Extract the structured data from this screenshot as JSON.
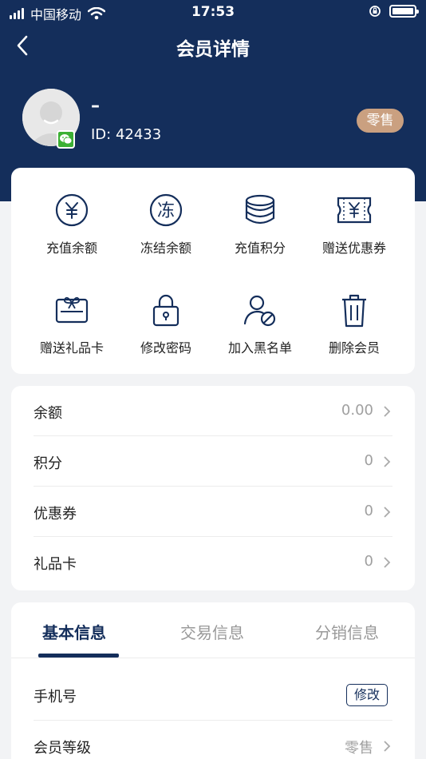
{
  "status_bar": {
    "carrier": "中国移动",
    "time": "17:53"
  },
  "nav": {
    "title": "会员详情"
  },
  "member": {
    "name": "–",
    "id": "ID: 42433",
    "level": "零售"
  },
  "actions": [
    {
      "label": "充值余额",
      "icon": "yuan-circle-icon"
    },
    {
      "label": "冻结余额",
      "icon": "freeze-icon"
    },
    {
      "label": "充值积分",
      "icon": "coin-stack-icon"
    },
    {
      "label": "赠送优惠券",
      "icon": "coupon-icon"
    },
    {
      "label": "赠送礼品卡",
      "icon": "gift-card-icon"
    },
    {
      "label": "修改密码",
      "icon": "lock-icon"
    },
    {
      "label": "加入黑名单",
      "icon": "user-blocked-icon"
    },
    {
      "label": "删除会员",
      "icon": "trash-icon"
    }
  ],
  "assets": [
    {
      "label": "余额",
      "value": "0.00"
    },
    {
      "label": "积分",
      "value": "0"
    },
    {
      "label": "优惠券",
      "value": "0"
    },
    {
      "label": "礼品卡",
      "value": "0"
    }
  ],
  "tabs": [
    {
      "label": "基本信息",
      "active": true
    },
    {
      "label": "交易信息",
      "active": false
    },
    {
      "label": "分销信息",
      "active": false
    }
  ],
  "basic_info": {
    "phone_label": "手机号",
    "phone_action": "修改",
    "level_label": "会员等级",
    "level_value": "零售"
  },
  "colors": {
    "primary": "#142e5b",
    "badge": "#caa080",
    "background": "#f2f3f5"
  }
}
